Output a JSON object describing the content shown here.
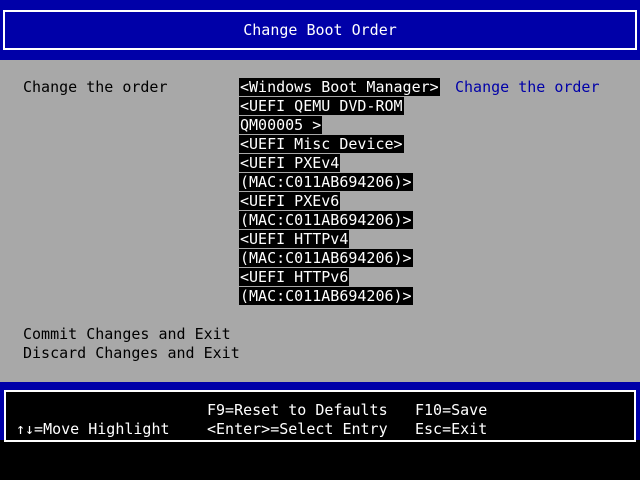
{
  "header": {
    "title": "Change Boot Order"
  },
  "main": {
    "prompt_label": "Change the order",
    "boot_entries": [
      "<Windows Boot Manager>",
      "<UEFI QEMU DVD-ROM",
      "QM00005 >",
      "<UEFI Misc Device>",
      "<UEFI PXEv4",
      "(MAC:C011AB694206)>",
      "<UEFI PXEv6",
      "(MAC:C011AB694206)>",
      "<UEFI HTTPv4",
      "(MAC:C011AB694206)>",
      "<UEFI HTTPv6",
      "(MAC:C011AB694206)>"
    ],
    "help_text": "Change the order",
    "commit_label": "Commit Changes and Exit",
    "discard_label": "Discard Changes and Exit"
  },
  "footer": {
    "move_highlight": "↑↓=Move Highlight",
    "reset_defaults": "F9=Reset to Defaults",
    "select_entry": "<Enter>=Select Entry",
    "save": "F10=Save",
    "exit": "Esc=Exit"
  },
  "colors": {
    "header_bg": "#0000a8",
    "panel_bg": "#a8a8a8",
    "help_text": "#0000a8",
    "highlight_bg": "#000000"
  }
}
